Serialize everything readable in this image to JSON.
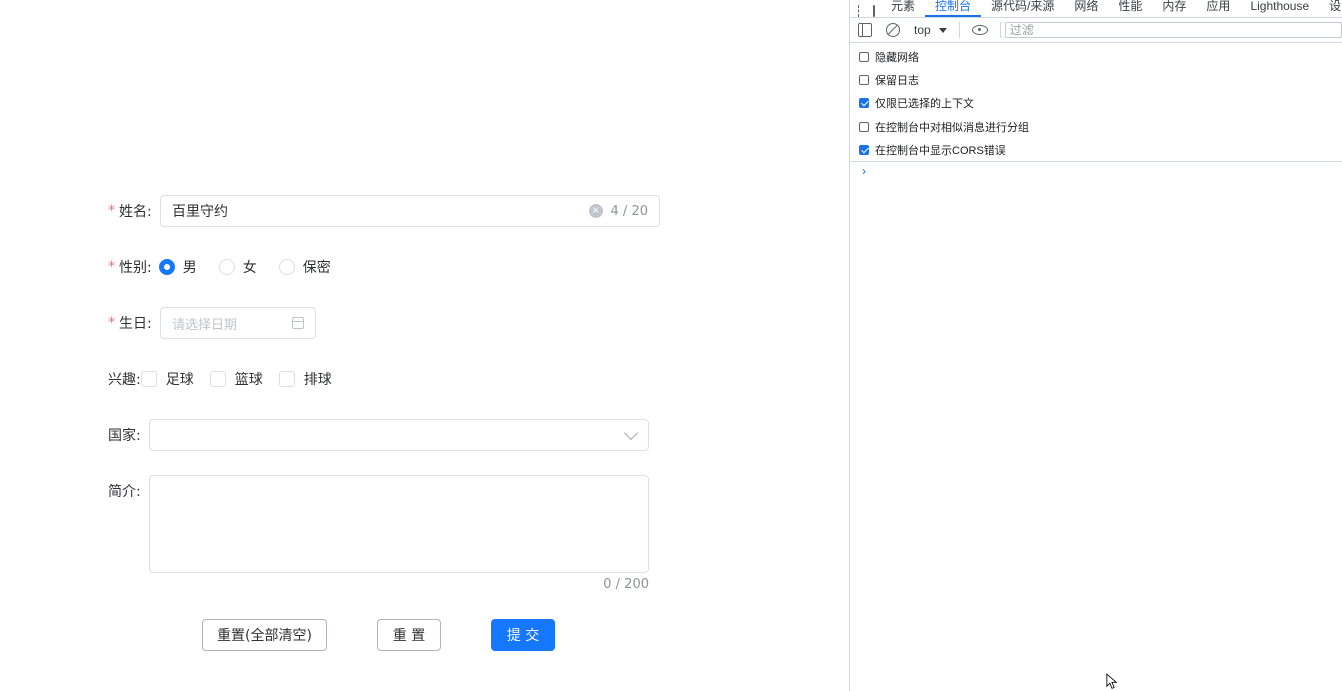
{
  "form": {
    "name": {
      "required": "*",
      "label": "姓名:",
      "value": "百里守约",
      "count": "4 / 20"
    },
    "gender": {
      "required": "*",
      "label": "性别:",
      "options": [
        "男",
        "女",
        "保密"
      ],
      "selected": 0
    },
    "birthday": {
      "required": "*",
      "label": "生日:",
      "placeholder": "请选择日期"
    },
    "hobbies": {
      "label": "兴趣:",
      "options": [
        "足球",
        "篮球",
        "排球"
      ]
    },
    "country": {
      "label": "国家:",
      "value": ""
    },
    "intro": {
      "label": "简介:",
      "count": "0 / 200"
    },
    "buttons": {
      "reset_all": "重置(全部清空)",
      "reset": "重 置",
      "submit": "提 交"
    }
  },
  "devtools": {
    "tabs": [
      "元素",
      "控制台",
      "源代码/来源",
      "网络",
      "性能",
      "内存",
      "应用",
      "Lighthouse",
      "设"
    ],
    "active_tab": "控制台",
    "context": "top",
    "filter_placeholder": "过滤",
    "options": [
      {
        "label": "隐藏网络",
        "checked": false
      },
      {
        "label": "保留日志",
        "checked": false
      },
      {
        "label": "仅限已选择的上下文",
        "checked": true
      },
      {
        "label": "在控制台中对相似消息进行分组",
        "checked": false
      },
      {
        "label": "在控制台中显示CORS错误",
        "checked": true
      }
    ],
    "prompt": "›"
  },
  "colors": {
    "primary": "#1677ff",
    "required": "#f56c6c",
    "devtools_accent": "#1a73e8"
  }
}
